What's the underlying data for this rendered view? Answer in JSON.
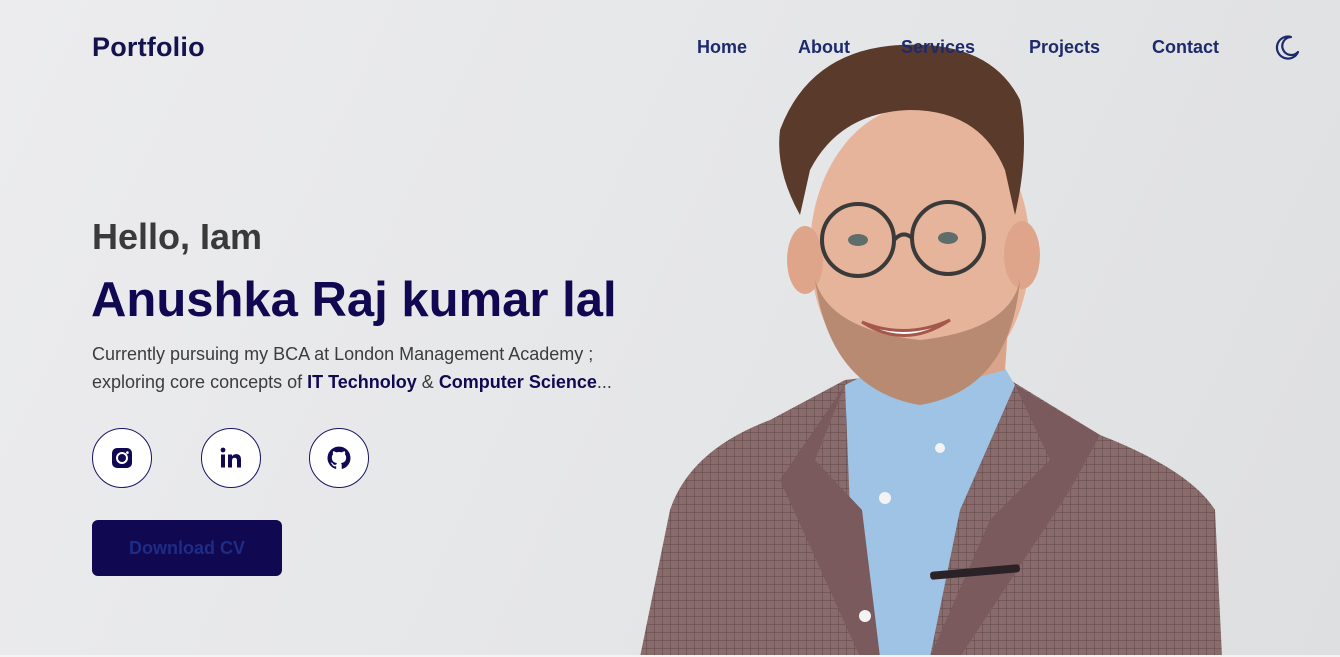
{
  "header": {
    "logo": "Portfolio",
    "nav": [
      "Home",
      "About",
      "Services",
      "Projects",
      "Contact"
    ],
    "theme_icon": "moon-icon"
  },
  "hero": {
    "greeting": "Hello, Iam",
    "name": "Anushka Raj kumar lal",
    "description": {
      "line1": "Currently pursuing my BCA at London Management Academy ;",
      "line2_prefix": "exploring core concepts of ",
      "highlight1": "IT Technoloy",
      "connector": " & ",
      "highlight2": "Computer Science",
      "suffix": "..."
    },
    "socials": [
      {
        "name": "instagram",
        "icon": "instagram-icon"
      },
      {
        "name": "linkedin",
        "icon": "linkedin-icon"
      },
      {
        "name": "github",
        "icon": "github-icon"
      }
    ],
    "cv_button": "Download CV"
  },
  "colors": {
    "primary": "#100952",
    "nav_text": "#1d2a6b",
    "body_text": "#3c3c3c"
  }
}
